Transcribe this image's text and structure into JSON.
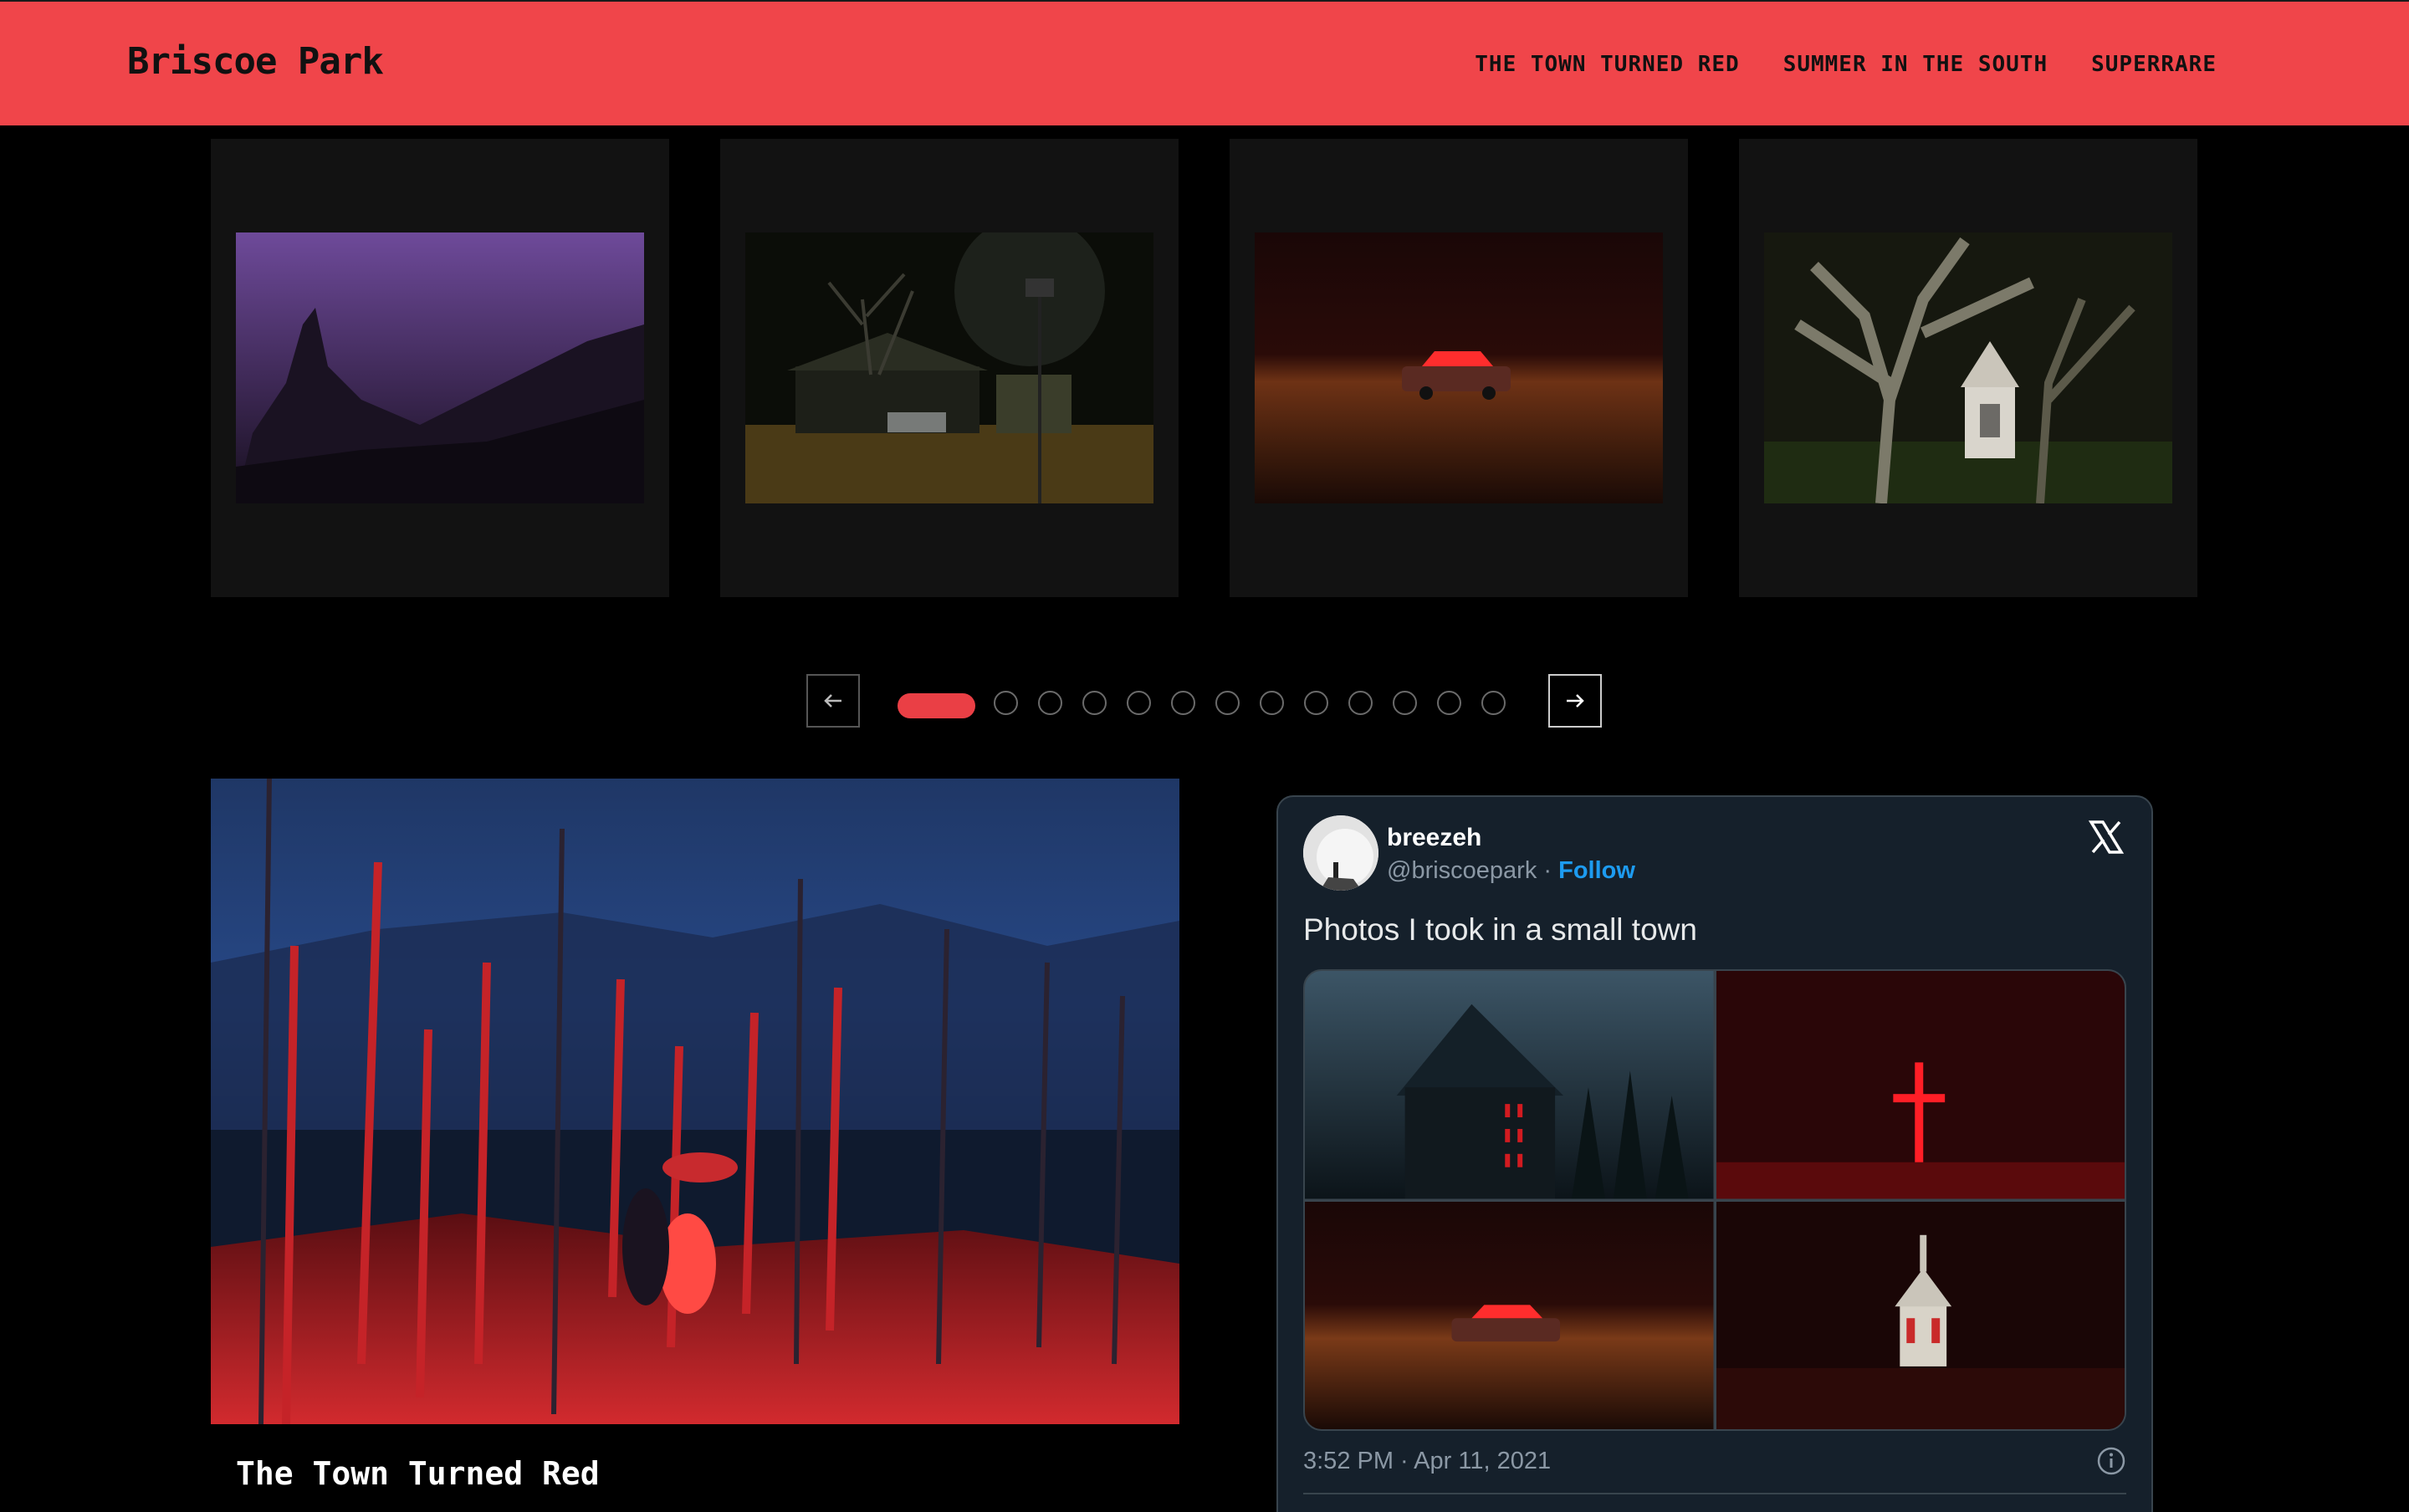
{
  "header": {
    "brand": "Briscoe Park",
    "nav": [
      "THE TOWN TURNED RED",
      "SUMMER IN THE SOUTH",
      "SUPERRARE"
    ]
  },
  "carousel": {
    "cards": [
      {
        "name": "misty-purple-peaks"
      },
      {
        "name": "night-house-birdhouse"
      },
      {
        "name": "red-car-field"
      },
      {
        "name": "oak-tree-chapel"
      }
    ],
    "total_pages": 13,
    "active_page": 1,
    "prev_icon": "arrow-left-icon",
    "next_icon": "arrow-right-icon"
  },
  "feature": {
    "title": "The Town Turned Red"
  },
  "tweet": {
    "name": "breezeh",
    "handle": "@briscoepark",
    "separator": " · ",
    "follow": "Follow",
    "text": "Photos I took in a small town",
    "time": "3:52 PM · Apr 11, 2021",
    "icons": {
      "logo": "x-logo-icon",
      "info": "info-icon"
    }
  },
  "colors": {
    "accent": "#f0454a",
    "background": "#000000",
    "card": "#121212",
    "tweet_bg": "#15202b",
    "link": "#1d9bf0"
  }
}
